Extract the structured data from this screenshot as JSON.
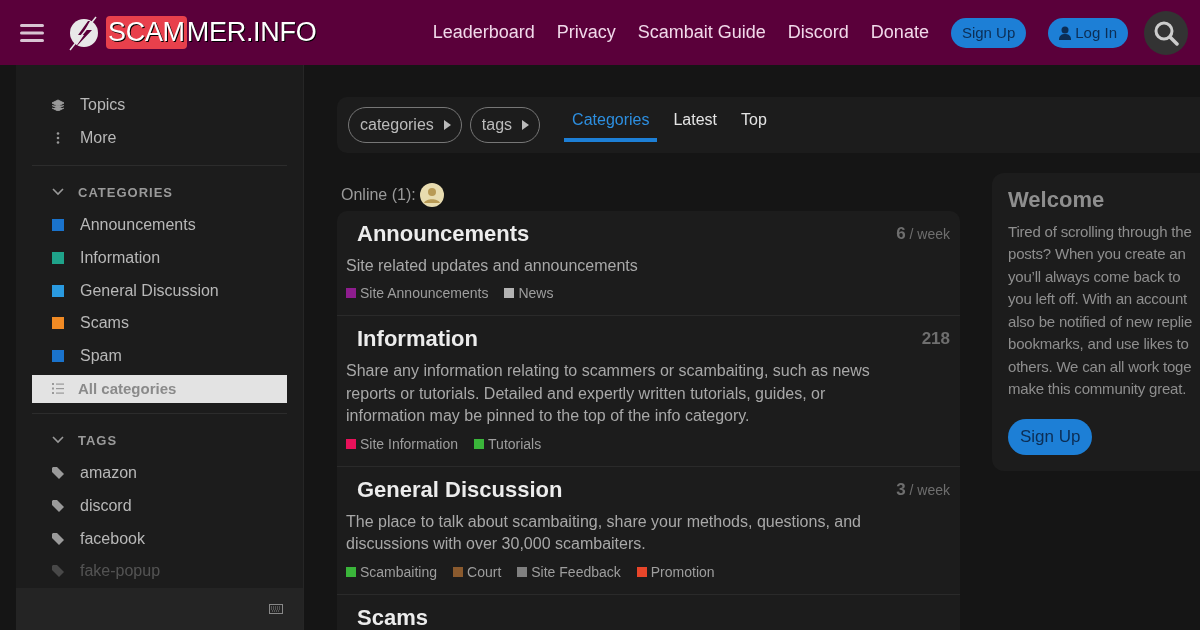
{
  "header": {
    "logo_highlight": "SCAM",
    "logo_rest": "MER.INFO",
    "links": [
      "Leaderboard",
      "Privacy",
      "Scambait Guide",
      "Discord",
      "Donate"
    ],
    "signup": "Sign Up",
    "login": "Log In"
  },
  "sidebar": {
    "top_items": [
      {
        "label": "Topics",
        "kind": "layers"
      },
      {
        "label": "More",
        "kind": "dots"
      }
    ],
    "categories_heading": "CATEGORIES",
    "categories_expanded": true,
    "categories": [
      {
        "label": "Announcements",
        "color": "#1a73cc"
      },
      {
        "label": "Information",
        "color": "#1fa38a"
      },
      {
        "label": "General Discussion",
        "color": "#2a9ae0"
      },
      {
        "label": "Scams",
        "color": "#f08a24"
      },
      {
        "label": "Spam",
        "color": "#1a73cc"
      }
    ],
    "all_categories": {
      "label": "All categories",
      "selected": true
    },
    "tags_heading": "TAGS",
    "tags_expanded": true,
    "tags": [
      {
        "label": "amazon",
        "faded": false
      },
      {
        "label": "discord",
        "faded": false
      },
      {
        "label": "facebook",
        "faded": false
      },
      {
        "label": "fake-popup",
        "faded": true
      }
    ]
  },
  "nav": {
    "chips": [
      "categories",
      "tags"
    ],
    "tabs": [
      {
        "label": "Categories",
        "selected": true
      },
      {
        "label": "Latest",
        "selected": false
      },
      {
        "label": "Top",
        "selected": false
      }
    ]
  },
  "online": "Online (1):",
  "categories": [
    {
      "name": "Announcements",
      "count": "6",
      "unit": "/ week",
      "description": "Site related updates and announcements",
      "subcategories": [
        {
          "label": "Site Announcements",
          "color": "#8e1d8e"
        },
        {
          "label": "News",
          "color": "#b3b3b3"
        }
      ]
    },
    {
      "name": "Information",
      "count": "218",
      "description": "Share any information relating to scammers or scambaiting, such as news reports or tutorials. Detailed and expertly written tutorials, guides, or information may be pinned to the top of the info category.",
      "subcategories": [
        {
          "label": "Site Information",
          "color": "#e8115a"
        },
        {
          "label": "Tutorials",
          "color": "#3ab53a"
        }
      ]
    },
    {
      "name": "General Discussion",
      "count": "3",
      "unit": "/ week",
      "description": "The place to talk about scambaiting, share your methods, questions, and discussions with over 30,000 scambaiters.",
      "subcategories": [
        {
          "label": "Scambaiting",
          "color": "#3ab53a"
        },
        {
          "label": "Court",
          "color": "#8a5a2e"
        },
        {
          "label": "Site Feedback",
          "color": "#808080"
        },
        {
          "label": "Promotion",
          "color": "#e8462a"
        }
      ]
    },
    {
      "name": "Scams"
    }
  ],
  "welcome": {
    "title": "Welcome",
    "lines": [
      "Tired of scrolling through the",
      "posts? When you create an",
      "you’ll always come back to",
      "you left off. With an account",
      "also be notified of new replie",
      "bookmarks, and use likes to",
      "others. We can all work toge",
      "make this community great."
    ],
    "button": "Sign Up"
  }
}
